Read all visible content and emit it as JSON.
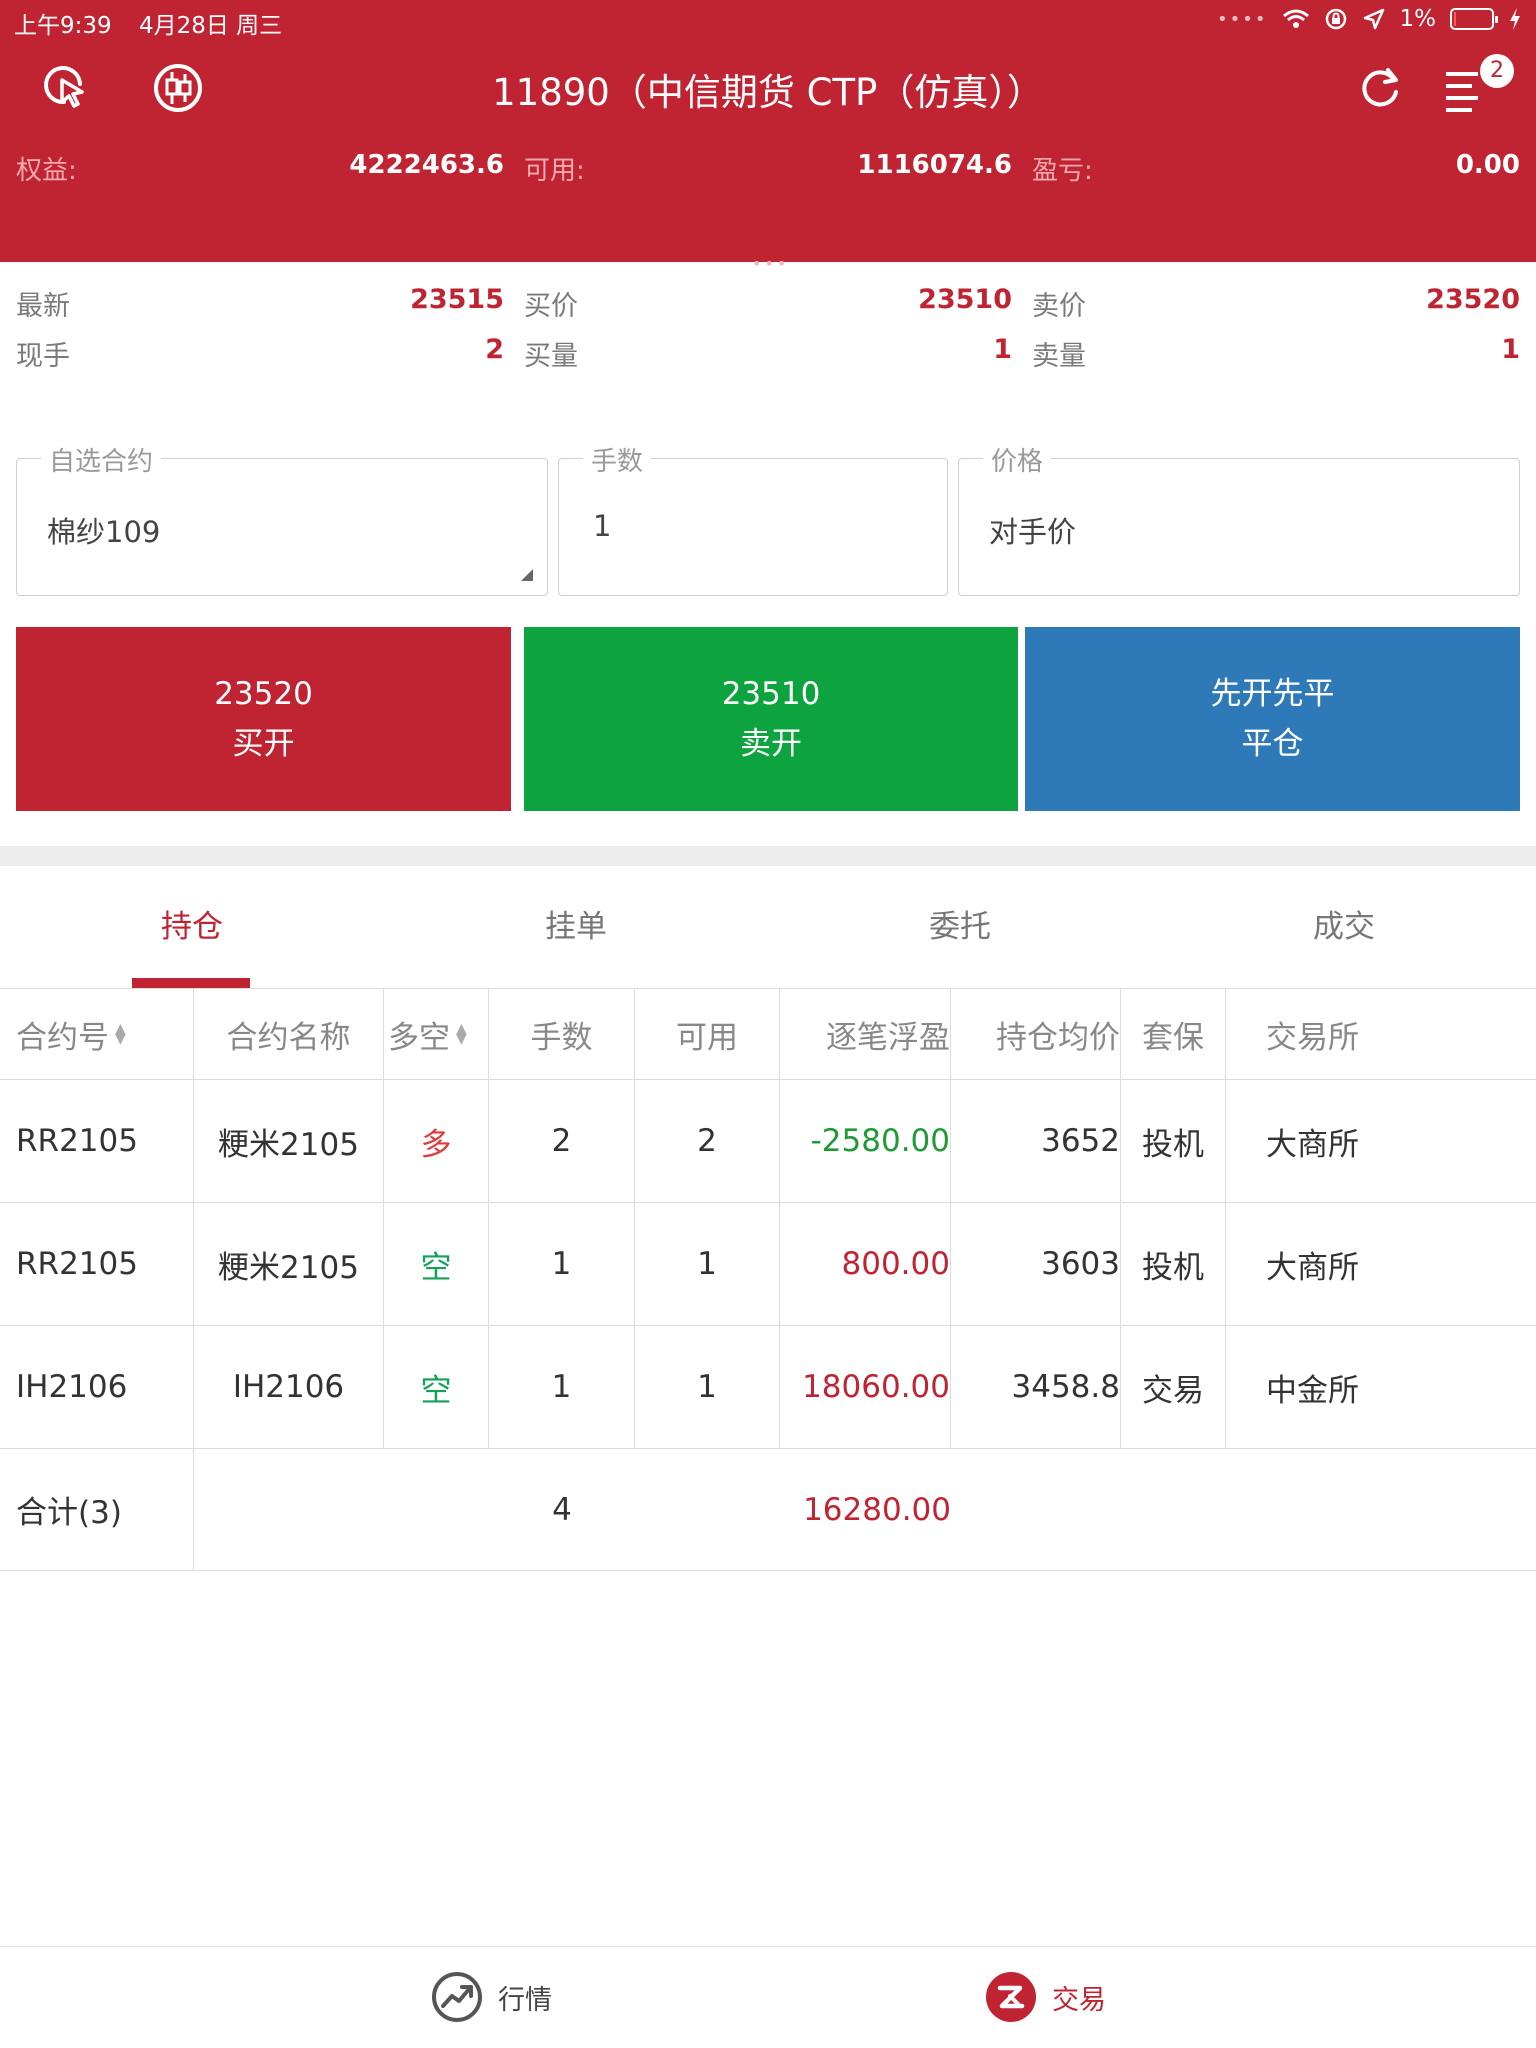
{
  "status_bar": {
    "time": "上午9:39",
    "date": "4月28日 周三",
    "battery": "1%",
    "battery_level": 0.01
  },
  "nav": {
    "title": "11890（中信期货 CTP（仿真））",
    "badge_count": "2"
  },
  "account": [
    {
      "label": "权益:",
      "value": "4222463.6"
    },
    {
      "label": "可用:",
      "value": "1116074.6"
    },
    {
      "label": "盈亏:",
      "value": "0.00"
    }
  ],
  "quote": [
    {
      "label": "最新",
      "value": "23515"
    },
    {
      "label": "买价",
      "value": "23510"
    },
    {
      "label": "卖价",
      "value": "23520"
    },
    {
      "label": "现手",
      "value": "2"
    },
    {
      "label": "买量",
      "value": "1"
    },
    {
      "label": "卖量",
      "value": "1"
    }
  ],
  "order": {
    "contract": {
      "legend": "自选合约",
      "value": "棉纱109"
    },
    "lots": {
      "legend": "手数",
      "value": "1"
    },
    "price": {
      "legend": "价格",
      "value": "对手价"
    }
  },
  "actions": {
    "buy": {
      "price": "23520",
      "label": "买开",
      "color": "#c02433"
    },
    "sell": {
      "price": "23510",
      "label": "卖开",
      "color": "#0da43f"
    },
    "close": {
      "mode": "先开先平",
      "label": "平仓",
      "color": "#2e79b7"
    }
  },
  "tabs": [
    "持仓",
    "挂单",
    "委托",
    "成交"
  ],
  "table": {
    "headers": [
      "合约号",
      "合约名称",
      "多空",
      "手数",
      "可用",
      "逐笔浮盈",
      "持仓均价",
      "套保",
      "交易所"
    ],
    "rows": [
      {
        "code": "RR2105",
        "name": "粳米2105",
        "dir": "多",
        "lots": "2",
        "avail": "2",
        "pnl": "-2580.00",
        "avg": "3652",
        "hedge": "投机",
        "exch": "大商所"
      },
      {
        "code": "RR2105",
        "name": "粳米2105",
        "dir": "空",
        "lots": "1",
        "avail": "1",
        "pnl": "800.00",
        "avg": "3603",
        "hedge": "投机",
        "exch": "大商所"
      },
      {
        "code": "IH2106",
        "name": "IH2106",
        "dir": "空",
        "lots": "1",
        "avail": "1",
        "pnl": "18060.00",
        "avg": "3458.8",
        "hedge": "交易",
        "exch": "中金所"
      }
    ],
    "total": {
      "label": "合计(3)",
      "lots": "4",
      "pnl": "16280.00"
    }
  },
  "bottom_nav": [
    {
      "label": "行情",
      "icon": "trend-chart-icon"
    },
    {
      "label": "交易",
      "icon": "trade-z-icon"
    }
  ]
}
